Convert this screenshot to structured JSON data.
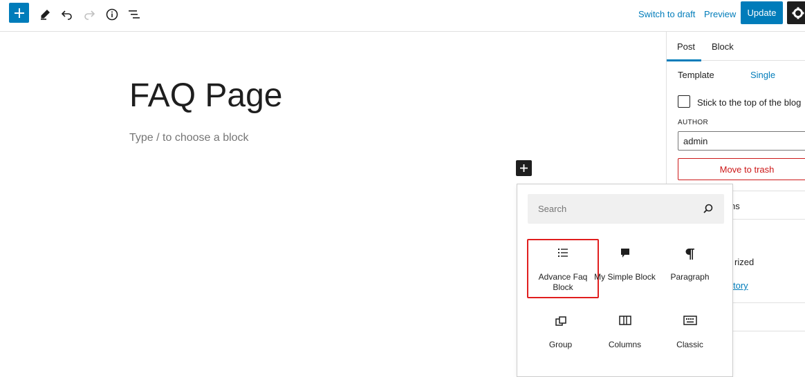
{
  "toolbar": {
    "switch_to_draft": "Switch to draft",
    "preview": "Preview",
    "update": "Update"
  },
  "editor": {
    "title": "FAQ Page",
    "placeholder": "Type / to choose a block"
  },
  "sidebar": {
    "tabs": [
      {
        "label": "Post"
      },
      {
        "label": "Block"
      }
    ],
    "template_label": "Template",
    "template_value": "Single",
    "sticky_label": "Stick to the top of the blog",
    "author_label": "AUTHOR",
    "author_value": "admin",
    "trash_label": "Move to trash",
    "partial_ns": "ns",
    "partial_rized": "rized",
    "partial_tory": "tory"
  },
  "inserter": {
    "search_placeholder": "Search",
    "blocks": [
      {
        "label": "Advance Faq Block",
        "icon": "list-icon"
      },
      {
        "label": "My Simple Block",
        "icon": "speech-bubble-icon"
      },
      {
        "label": "Paragraph",
        "icon": "paragraph-icon"
      },
      {
        "label": "Group",
        "icon": "group-icon"
      },
      {
        "label": "Columns",
        "icon": "columns-icon"
      },
      {
        "label": "Classic",
        "icon": "keyboard-icon"
      }
    ]
  },
  "colors": {
    "accent": "#007cba",
    "danger": "#cc1818",
    "highlight": "#e01e1e"
  }
}
